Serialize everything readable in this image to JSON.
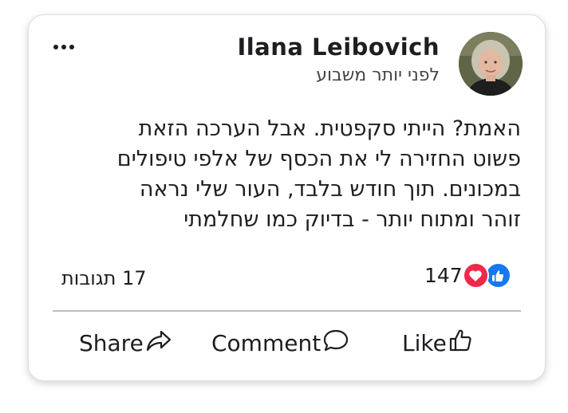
{
  "post": {
    "author": "Ilana Leibovich",
    "time": "לפני יותר משבוע",
    "text_lines": [
      "האמת? הייתי סקפטית. אבל הערכה הזאת",
      "פשוט החזירה לי את הכסף של אלפי טיפולים",
      "במכונים. תוך חודש בלבד, העור שלי נראה",
      "זוהר ומתוח יותר - בדיוק כמו שחלמתי"
    ],
    "reactions_count": "147",
    "comments_count": "17 תגובות",
    "reaction_icons": [
      "like-icon",
      "love-icon"
    ]
  },
  "actions": {
    "share": "Share",
    "comment": "Comment",
    "like": "Like"
  },
  "colors": {
    "like_blue": "#1877f2",
    "love_red": "#f02849",
    "divider": "#b8bec4"
  }
}
